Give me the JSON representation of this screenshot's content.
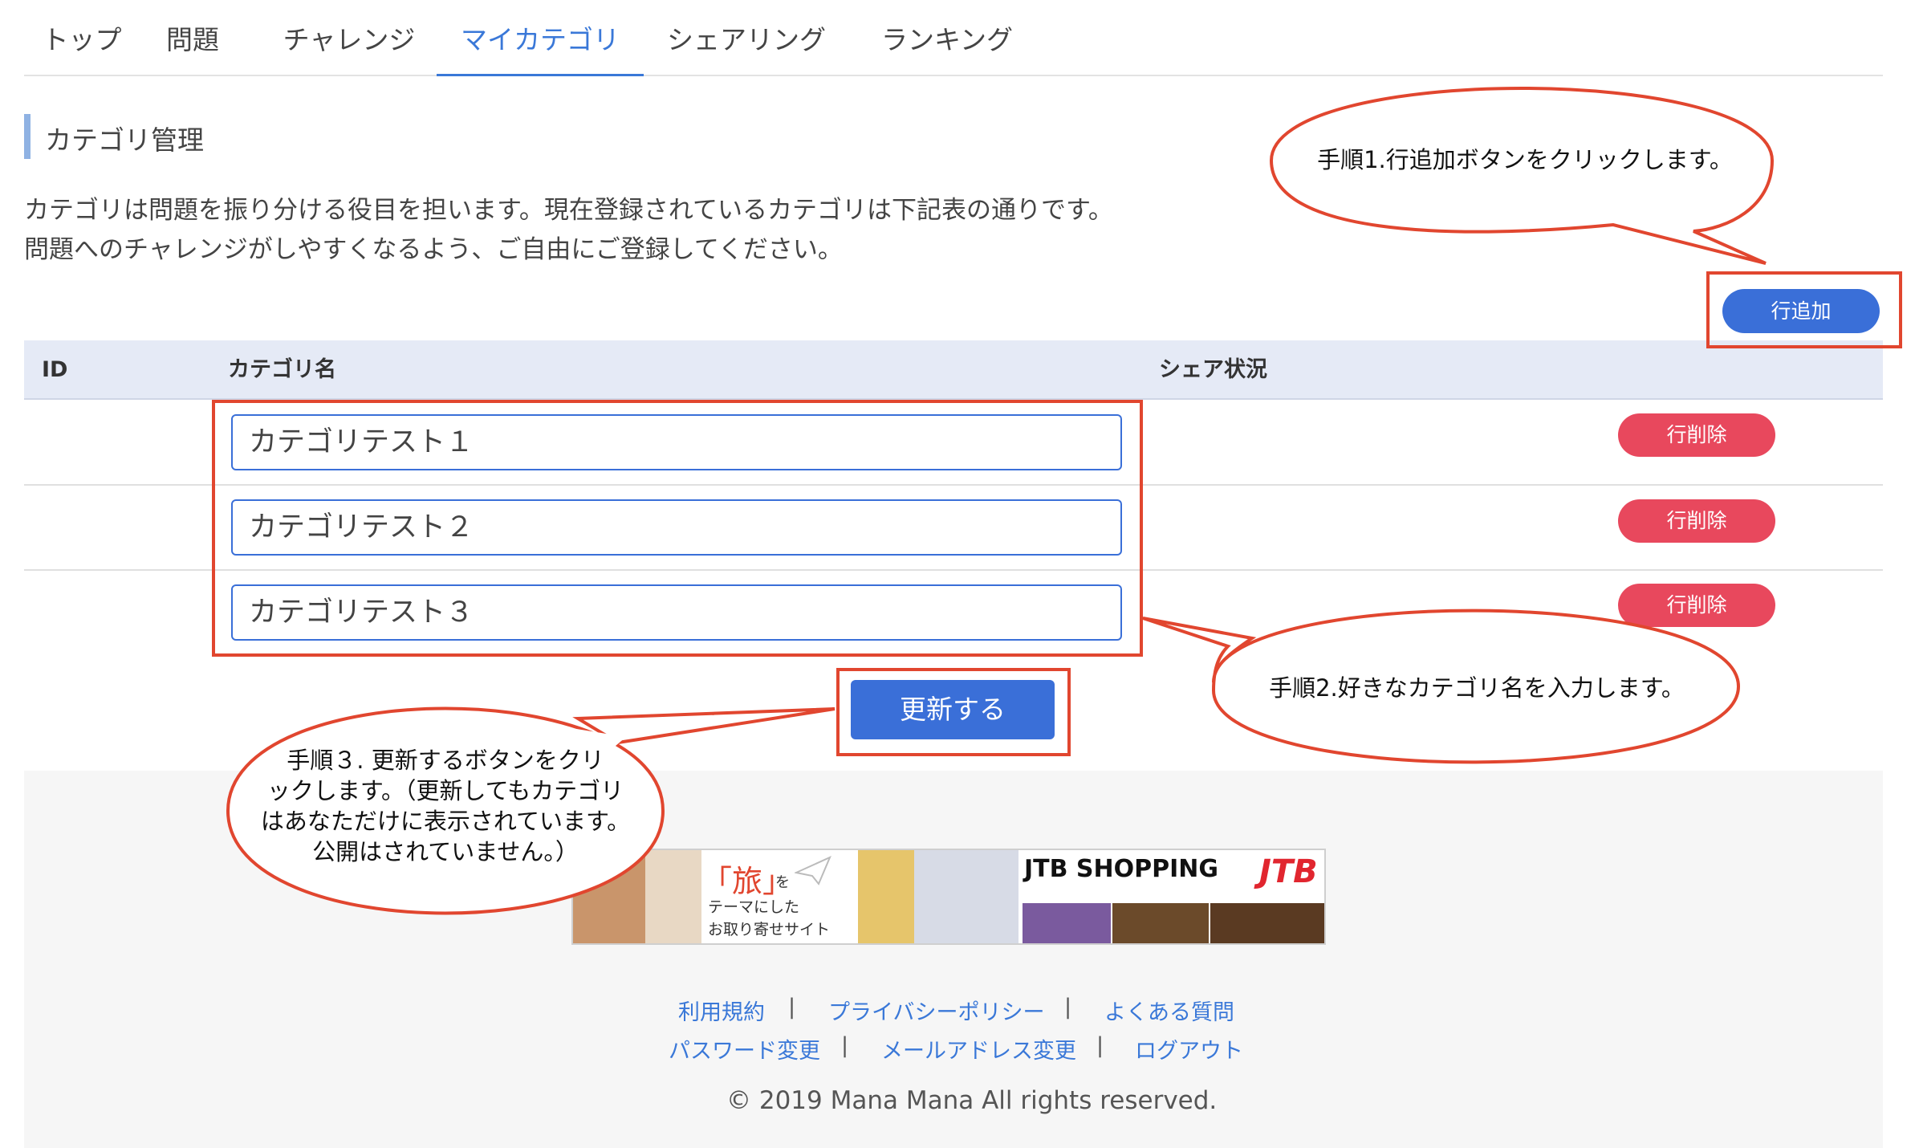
{
  "tabs": [
    "トップ",
    "問題",
    "チャレンジ",
    "マイカテゴリ",
    "シェアリング",
    "ランキング"
  ],
  "active_tab": "マイカテゴリ",
  "section": {
    "title": "カテゴリ管理",
    "desc1": "カテゴリは問題を振り分ける役目を担います。現在登録されているカテゴリは下記表の通りです。",
    "desc2": "問題へのチャレンジがしやすくなるよう、ご自由にご登録してください。"
  },
  "add_row_label": "行追加",
  "table": {
    "headers": [
      "ID",
      "カテゴリ名",
      "シェア状況"
    ],
    "rows": [
      {
        "id": "",
        "name": "カテゴリテスト１",
        "delete_label": "行削除"
      },
      {
        "id": "",
        "name": "カテゴリテスト２",
        "delete_label": "行削除"
      },
      {
        "id": "",
        "name": "カテゴリテスト３",
        "delete_label": "行削除"
      }
    ]
  },
  "update_label": "更新する",
  "callouts": {
    "step1": "手順1.行追加ボタンをクリックします。",
    "step2": "手順2.好きなカテゴリ名を入力します。",
    "step3_lines": [
      "手順３. 更新するボタンをクリ",
      "ックします。（更新してもカテゴリ",
      "はあなただけに表示されています。",
      "公開はされていません。）"
    ]
  },
  "banner": {
    "tabi": "「旅」",
    "wo": "を",
    "line2": "テーマにした",
    "line3": "お取り寄せサイト",
    "brand": "JTB SHOPPING",
    "logo": "JTB"
  },
  "footer": {
    "links_row1": [
      "利用規約",
      "プライバシーポリシー",
      "よくある質問"
    ],
    "links_row2": [
      "パスワード変更",
      "メールアドレス変更",
      "ログアウト"
    ],
    "separator": "|",
    "copyright": "© 2019 Mana Mana All rights reserved."
  },
  "colors": {
    "accent": "#3a6fd8",
    "danger": "#e8485d",
    "annotation": "#e1462f"
  }
}
